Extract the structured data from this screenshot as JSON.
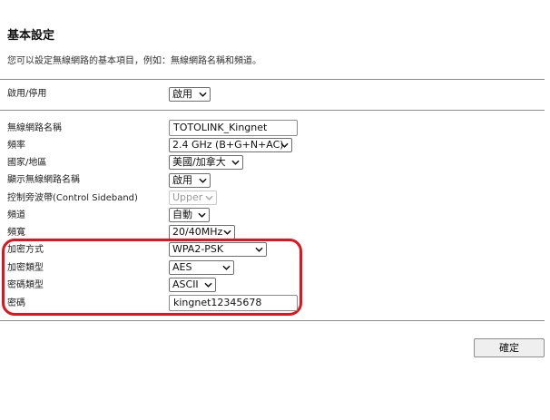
{
  "page": {
    "title": "基本設定",
    "description": "您可以設定無線網路的基本項目，例如：無線網路名稱和頻道。"
  },
  "enable": {
    "label": "啟用/停用",
    "value": "啟用"
  },
  "fields": {
    "ssid": {
      "label": "無線網路名稱",
      "value": "TOTOLINK_Kingnet"
    },
    "band": {
      "label": "頻率",
      "value": "2.4 GHz (B+G+N+AC)"
    },
    "region": {
      "label": "國家/地區",
      "value": "美國/加拿大"
    },
    "broadcast_ssid": {
      "label": "顯示無線網路名稱",
      "value": "啟用"
    },
    "control_sideband": {
      "label": "控制旁波帶(Control Sideband)",
      "value": "Upper"
    },
    "channel": {
      "label": "頻道",
      "value": "自動"
    },
    "bandwidth": {
      "label": "頻寬",
      "value": "20/40MHz"
    },
    "encryption": {
      "label": "加密方式",
      "value": "WPA2-PSK"
    },
    "cipher": {
      "label": "加密類型",
      "value": "AES"
    },
    "key_format": {
      "label": "密碼類型",
      "value": "ASCII"
    },
    "password": {
      "label": "密碼",
      "value": "kingnet12345678"
    }
  },
  "buttons": {
    "confirm": "確定"
  },
  "colors": {
    "highlight": "#e0141e",
    "divider": "#8a8a8a"
  },
  "icons": {
    "dropdown": "chevron-down-icon"
  }
}
